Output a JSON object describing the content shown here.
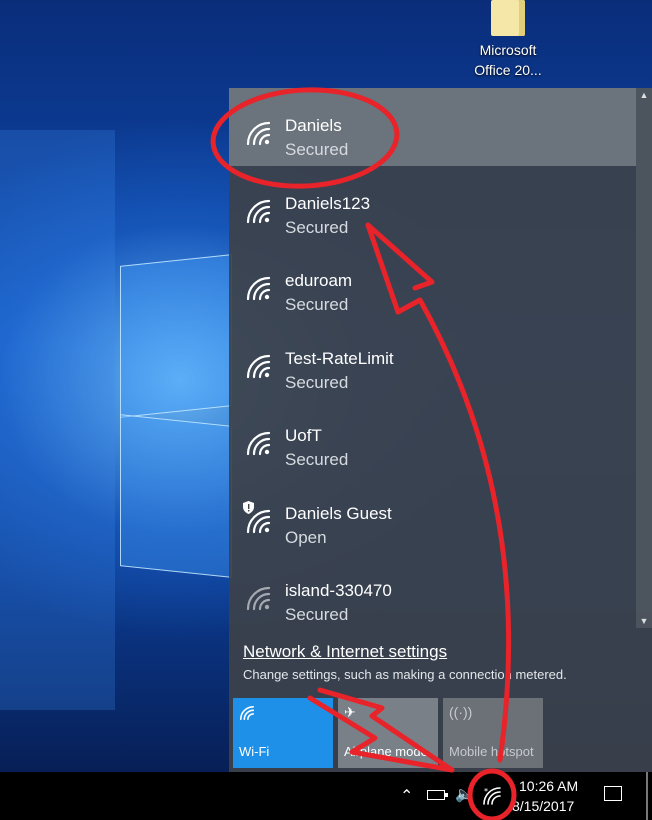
{
  "desktop": {
    "icon": {
      "label": "Microsoft Office 20..."
    }
  },
  "flyout": {
    "networks": [
      {
        "name": "Daniels",
        "status": "Secured",
        "selected": true,
        "icon": "wifi-icon"
      },
      {
        "name": "Daniels123",
        "status": "Secured",
        "icon": "wifi-icon"
      },
      {
        "name": "eduroam",
        "status": "Secured",
        "icon": "wifi-icon"
      },
      {
        "name": "Test-RateLimit",
        "status": "Secured",
        "icon": "wifi-icon"
      },
      {
        "name": "UofT",
        "status": "Secured",
        "icon": "wifi-icon"
      },
      {
        "name": "Daniels Guest",
        "status": "Open",
        "icon": "wifi-shield-icon"
      },
      {
        "name": "island-330470",
        "status": "Secured",
        "icon": "wifi-weak-icon"
      }
    ],
    "settings_link": "Network & Internet settings",
    "settings_desc": "Change settings, such as making a connection metered.",
    "quick_actions": {
      "wifi": {
        "label": "Wi-Fi",
        "icon": "wifi-icon",
        "color": "#1e90e8"
      },
      "airplane": {
        "label": "Airplane mode",
        "icon": "airplane-icon"
      },
      "hotspot": {
        "label": "Mobile hotspot",
        "icon": "hotspot-icon"
      }
    }
  },
  "taskbar": {
    "time": "10:26 AM",
    "date": "8/15/2017",
    "tray_icons": [
      "chevron-up-icon",
      "battery-icon",
      "volume-icon",
      "wifi-icon",
      "notification-icon"
    ]
  },
  "annotation_color": "#e8232a"
}
